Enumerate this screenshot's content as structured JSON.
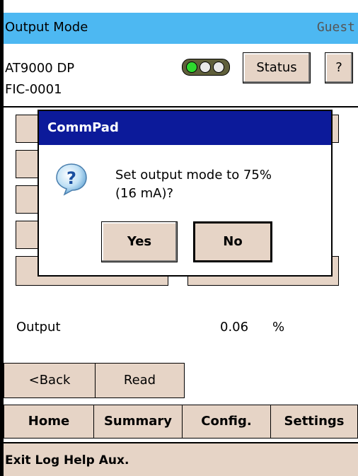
{
  "titlebar": {
    "title": "Output Mode",
    "user": "Guest"
  },
  "device": {
    "model": "AT9000 DP",
    "tag": "FIC-0001"
  },
  "header_buttons": {
    "status": "Status",
    "help": "?"
  },
  "output": {
    "label": "Output",
    "value": "0.06",
    "unit": "%"
  },
  "nav": {
    "back": "<Back",
    "read": "Read"
  },
  "tabs": [
    "Home",
    "Summary",
    "Config.",
    "Settings"
  ],
  "menu": {
    "text": "Exit Log Help Aux."
  },
  "dialog": {
    "title": "CommPad",
    "message_line1": "Set output mode to 75%",
    "message_line2": "(16 mA)?",
    "yes": "Yes",
    "no": "No"
  },
  "colors": {
    "titlebar": "#4DB8F2",
    "button": "#E6D4C6",
    "dialog_title": "#0C1A9A"
  },
  "icons": {
    "dialog": "question-icon",
    "status_lights": "traffic-light-icon"
  }
}
